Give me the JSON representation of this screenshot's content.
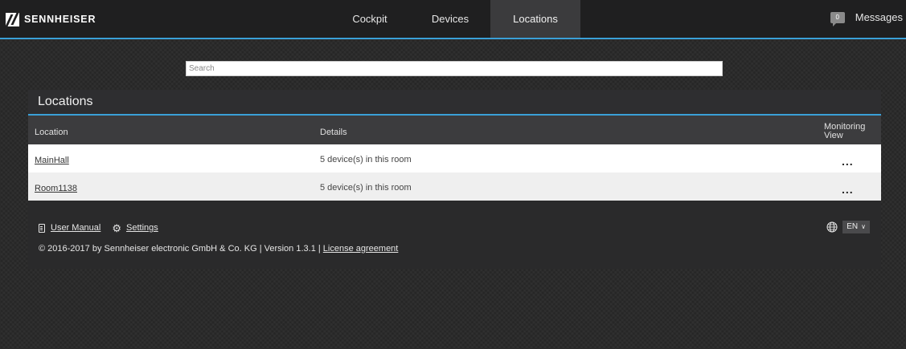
{
  "header": {
    "brand": "SENNHEISER",
    "tabs": [
      {
        "label": "Cockpit"
      },
      {
        "label": "Devices"
      },
      {
        "label": "Locations",
        "active": true
      }
    ],
    "messages": {
      "count": "0",
      "label": "Messages"
    }
  },
  "search": {
    "placeholder": "Search",
    "value": ""
  },
  "panel": {
    "title": "Locations",
    "columns": [
      "Location",
      "Details",
      "Monitoring View"
    ],
    "rows": [
      {
        "location": "MainHall",
        "details": "5 device(s) in this room",
        "more": "..."
      },
      {
        "location": "Room1138",
        "details": "5 device(s) in this room",
        "more": "..."
      }
    ]
  },
  "footer": {
    "user_manual": "User Manual",
    "settings": "Settings",
    "copyright": "© 2016-2017 by Sennheiser electronic GmbH & Co. KG | Version 1.3.1 | ",
    "license": "License agreement",
    "language": "EN"
  },
  "colors": {
    "accent": "#3aa0d8",
    "header_bg": "#1f1f20",
    "active_tab_bg": "#3b3b3d"
  }
}
